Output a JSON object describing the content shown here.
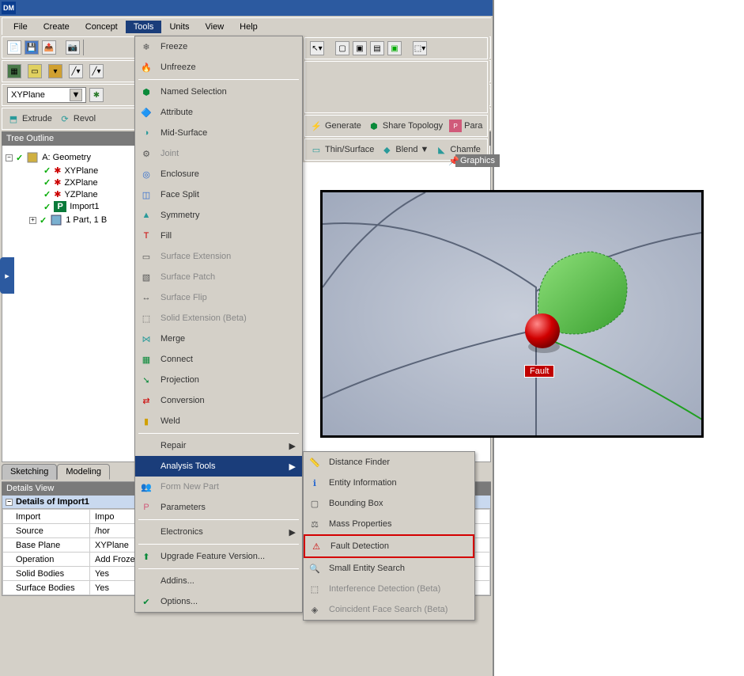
{
  "app_abbr": "DM",
  "menubar": {
    "file": "File",
    "create": "Create",
    "concept": "Concept",
    "tools": "Tools",
    "units": "Units",
    "view": "View",
    "help": "Help"
  },
  "dropdown_plane": "XYPlane",
  "ribbon1": {
    "extrude": "Extrude",
    "revolve": "Revol"
  },
  "right_ribbon1": {
    "generate": "Generate",
    "share": "Share Topology",
    "para": "Para"
  },
  "right_ribbon2": {
    "thin": "Thin/Surface",
    "blend": "Blend",
    "chamfer": "Chamfe"
  },
  "graphics_label": "Graphics",
  "tree_header": "Tree Outline",
  "tree": {
    "root": "A: Geometry",
    "xy": "XYPlane",
    "zx": "ZXPlane",
    "yz": "YZPlane",
    "import": "Import1",
    "parts": "1 Part, 1 B"
  },
  "tabs": {
    "sketching": "Sketching",
    "modeling": "Modeling"
  },
  "details_header": "Details View",
  "details_group": "Details of Import1",
  "details": [
    {
      "k": "Import",
      "v": "Impo"
    },
    {
      "k": "Source",
      "v": "/hor"
    },
    {
      "k": "Base Plane",
      "v": "XYPlane"
    },
    {
      "k": "Operation",
      "v": "Add Frozen"
    },
    {
      "k": "Solid Bodies",
      "v": "Yes"
    },
    {
      "k": "Surface Bodies",
      "v": "Yes"
    }
  ],
  "tools_menu": [
    {
      "label": "Freeze",
      "icon": "freeze"
    },
    {
      "label": "Unfreeze",
      "icon": "unfreeze",
      "sep_after": true
    },
    {
      "label": "Named Selection",
      "icon": "named"
    },
    {
      "label": "Attribute",
      "icon": "attr"
    },
    {
      "label": "Mid-Surface",
      "icon": "midsurf"
    },
    {
      "label": "Joint",
      "icon": "joint",
      "disabled": true
    },
    {
      "label": "Enclosure",
      "icon": "enclosure"
    },
    {
      "label": "Face Split",
      "icon": "facesplit"
    },
    {
      "label": "Symmetry",
      "icon": "symmetry"
    },
    {
      "label": "Fill",
      "icon": "fill"
    },
    {
      "label": "Surface Extension",
      "icon": "surfext",
      "disabled": true
    },
    {
      "label": "Surface Patch",
      "icon": "surfpatch",
      "disabled": true
    },
    {
      "label": "Surface Flip",
      "icon": "surfflip",
      "disabled": true
    },
    {
      "label": "Solid Extension (Beta)",
      "icon": "solidext",
      "disabled": true
    },
    {
      "label": "Merge",
      "icon": "merge"
    },
    {
      "label": "Connect",
      "icon": "connect"
    },
    {
      "label": "Projection",
      "icon": "projection"
    },
    {
      "label": "Conversion",
      "icon": "conversion"
    },
    {
      "label": "Weld",
      "icon": "weld",
      "sep_after": true
    },
    {
      "label": "Repair",
      "submenu": true
    },
    {
      "label": "Analysis Tools",
      "submenu": true,
      "highlight": true
    },
    {
      "label": "Form New Part",
      "icon": "formnew",
      "disabled": true
    },
    {
      "label": "Parameters",
      "icon": "params",
      "sep_after": true
    },
    {
      "label": "Electronics",
      "submenu": true,
      "sep_after": true
    },
    {
      "label": "Upgrade Feature Version...",
      "icon": "upgrade",
      "sep_after": true
    },
    {
      "label": "Addins..."
    },
    {
      "label": "Options...",
      "icon": "options"
    }
  ],
  "analysis_submenu": [
    {
      "label": "Distance Finder",
      "icon": "distance"
    },
    {
      "label": "Entity Information",
      "icon": "entity"
    },
    {
      "label": "Bounding Box",
      "icon": "bbox"
    },
    {
      "label": "Mass Properties",
      "icon": "mass"
    },
    {
      "label": "Fault Detection",
      "icon": "fault",
      "boxed": true
    },
    {
      "label": "Small Entity Search",
      "icon": "smallent"
    },
    {
      "label": "Interference Detection (Beta)",
      "icon": "interference",
      "disabled": true
    },
    {
      "label": "Coincident Face Search (Beta)",
      "icon": "coincident",
      "disabled": true
    }
  ],
  "viewport_label": "Fault",
  "blend_arrow": "▼"
}
